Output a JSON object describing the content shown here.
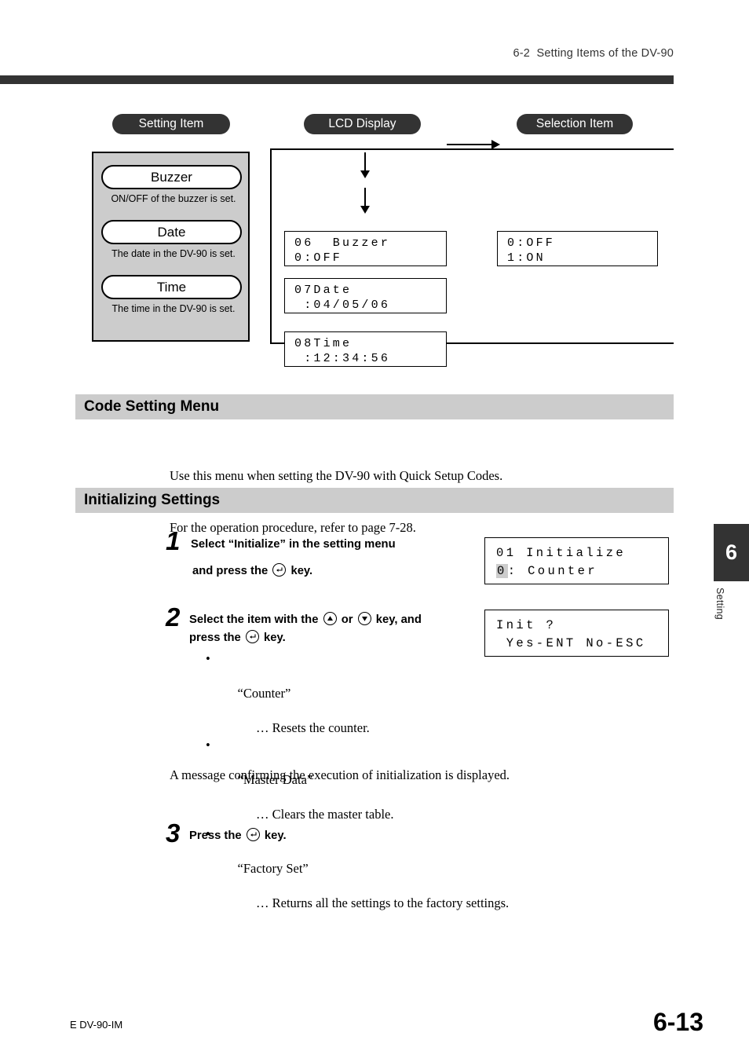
{
  "header": {
    "title": "6-2  Setting Items of the DV-90"
  },
  "diagram": {
    "column_labels": {
      "setting_item": "Setting Item",
      "lcd_display": "LCD Display",
      "selection_item": "Selection Item"
    },
    "setting_items": [
      {
        "name": "Buzzer",
        "description": "ON/OFF of the buzzer is set."
      },
      {
        "name": "Date",
        "description": "The date in the DV-90 is set."
      },
      {
        "name": "Time",
        "description": "The time in the DV-90 is set."
      }
    ],
    "lcd_screens": [
      {
        "line1": "06  Buzzer",
        "line2": "0:OFF"
      },
      {
        "line1": "07Date",
        "line2": " :04/05/06"
      },
      {
        "line1": "08Time",
        "line2": " :12:34:56"
      }
    ],
    "selection_screen": {
      "line1": "0:OFF",
      "line2": "1:ON"
    }
  },
  "code_setting_menu": {
    "heading": "Code Setting Menu",
    "paragraph_line1": "Use this menu when setting the DV-90 with Quick Setup Codes.",
    "paragraph_line2": "For the operation procedure, refer to page 7-28."
  },
  "initializing_settings": {
    "heading": "Initializing Settings",
    "steps": [
      {
        "number": "1",
        "line1": "Select “Initialize” in the setting menu",
        "line2_before": "and press the",
        "line2_after": "key."
      },
      {
        "number": "2",
        "line1_before": "Select the item with the",
        "line1_mid": "or",
        "line1_after": "key, and",
        "line2_before": "press the",
        "line2_after": "key."
      },
      {
        "number": "3",
        "line1_before": "Press the",
        "line1_after": "key."
      }
    ],
    "bullets": [
      {
        "bullet": "•",
        "term": "“Counter”",
        "description": "… Resets the counter."
      },
      {
        "bullet": "•",
        "term": "“Master Data”",
        "description": "… Clears the master table."
      },
      {
        "bullet": "•",
        "term": "“Factory Set”",
        "description": "… Returns all the settings to the factory settings."
      }
    ],
    "confirmation_paragraph": "A message confirming the execution of initialization is displayed.",
    "step_lcd_1": {
      "line1": "01 Initialize",
      "cursor": "0",
      "line2_rest": ": Counter"
    },
    "step_lcd_2": {
      "line1": "Init ?",
      "line2": " Yes-ENT No-ESC"
    }
  },
  "icons": {
    "enter_key": "enter-key-icon",
    "up_key": "up-arrow-key-icon",
    "down_key": "down-arrow-key-icon"
  },
  "thumb_tab": {
    "chapter": "6",
    "label": "Setting"
  },
  "footer": {
    "left": "E DV-90-IM",
    "page": "6-13"
  },
  "colors": {
    "dark": "#333333",
    "gray_bar": "#cccccc",
    "cursor": "#cccccc"
  }
}
